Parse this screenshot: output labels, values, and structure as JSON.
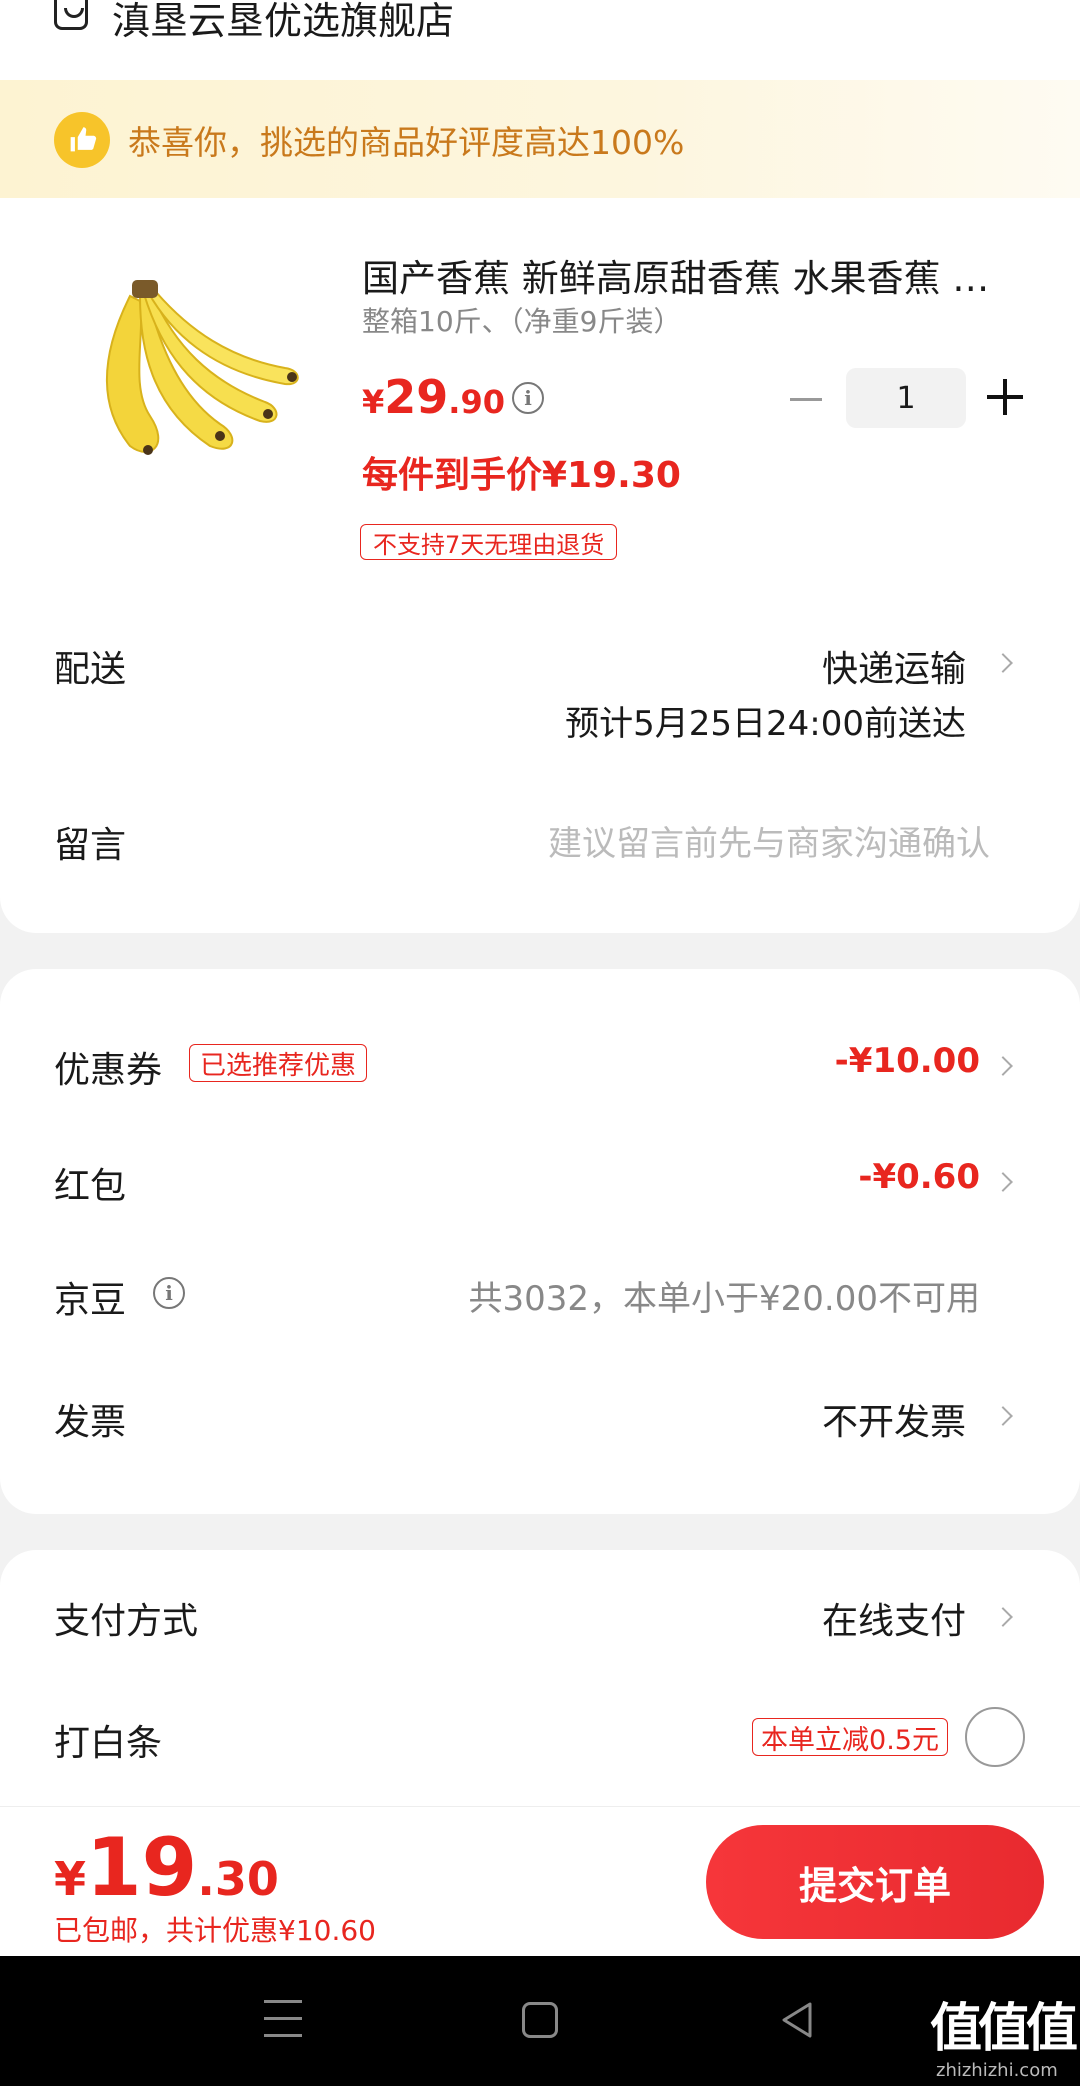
{
  "store": {
    "name": "滇垦云垦优选旗舰店",
    "icon": "store-icon"
  },
  "banner": {
    "text": "恭喜你，挑选的商品好评度高达100%",
    "icon": "thumbs-up-icon"
  },
  "product": {
    "title": "国产香蕉 新鲜高原甜香蕉 水果香蕉 …",
    "spec": "整箱10斤、（净重9斤装）",
    "price_currency": "¥",
    "price_int": "29",
    "price_dec": ".90",
    "quantity": "1",
    "final_price": "每件到手价¥19.30",
    "return_tag": "不支持7天无理由退货"
  },
  "delivery": {
    "label": "配送",
    "method": "快递运输",
    "estimate": "预计5月25日24:00前送达"
  },
  "message": {
    "label": "留言",
    "placeholder": "建议留言前先与商家沟通确认"
  },
  "coupon": {
    "label": "优惠券",
    "tag": "已选推荐优惠",
    "value": "-¥10.00"
  },
  "redpacket": {
    "label": "红包",
    "value": "-¥0.60"
  },
  "jingdou": {
    "label": "京豆",
    "value": "共3032，本单小于¥20.00不可用"
  },
  "invoice": {
    "label": "发票",
    "value": "不开发票"
  },
  "payment": {
    "label": "支付方式",
    "value": "在线支付"
  },
  "baitiao": {
    "label": "打白条",
    "tag": "本单立减0.5元"
  },
  "bottom": {
    "currency": "¥",
    "total_int": "19",
    "total_dec": ".30",
    "note": "已包邮，共计优惠¥10.60",
    "submit_label": "提交订单"
  },
  "watermark": {
    "text": "值值值",
    "url": "zhizhizhi.com"
  },
  "colors": {
    "accent": "#e8261f",
    "banner_text": "#c9791c",
    "banner_icon": "#f7c42a"
  }
}
